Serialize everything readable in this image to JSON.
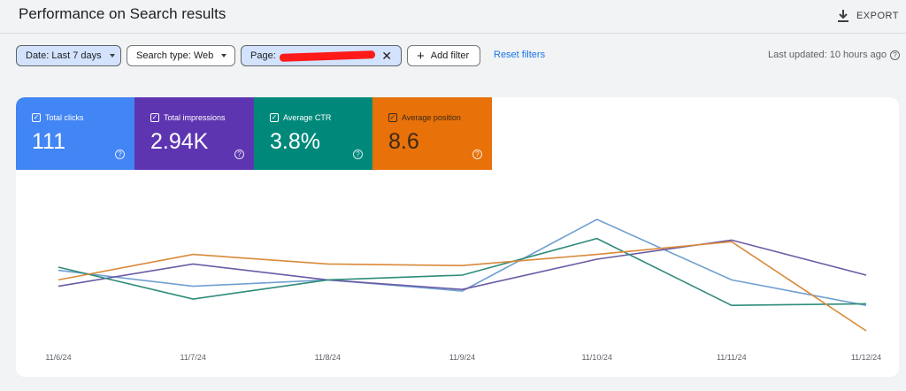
{
  "header": {
    "title": "Performance on Search results",
    "export_label": "EXPORT"
  },
  "filters": {
    "date": "Date: Last 7 days",
    "search_type": "Search type: Web",
    "page": "Page:",
    "add_filter": "Add filter",
    "reset": "Reset filters",
    "last_updated": "Last updated: 10 hours ago"
  },
  "metrics": [
    {
      "label": "Total clicks",
      "value": "111",
      "color": "#4285f4"
    },
    {
      "label": "Total impressions",
      "value": "2.94K",
      "color": "#5e35b1"
    },
    {
      "label": "Average CTR",
      "value": "3.8%",
      "color": "#00897b"
    },
    {
      "label": "Average position",
      "value": "8.6",
      "color": "#e8710a"
    }
  ],
  "chart_data": {
    "type": "line",
    "x": [
      "11/6/24",
      "11/7/24",
      "11/8/24",
      "11/9/24",
      "11/10/24",
      "11/11/24",
      "11/12/24"
    ],
    "series": [
      {
        "name": "Total clicks",
        "color": "#6fa0d0",
        "values": [
          0.48,
          0.38,
          0.42,
          0.35,
          0.8,
          0.42,
          0.26
        ]
      },
      {
        "name": "Total impressions",
        "color": "#6b5aa6",
        "values": [
          0.38,
          0.52,
          0.42,
          0.36,
          0.55,
          0.67,
          0.45
        ]
      },
      {
        "name": "Average CTR",
        "color": "#2e8b7a",
        "values": [
          0.5,
          0.3,
          0.42,
          0.45,
          0.68,
          0.26,
          0.27
        ]
      },
      {
        "name": "Average position",
        "color": "#d9893a",
        "values": [
          0.42,
          0.58,
          0.52,
          0.51,
          0.58,
          0.66,
          0.1
        ]
      }
    ]
  }
}
